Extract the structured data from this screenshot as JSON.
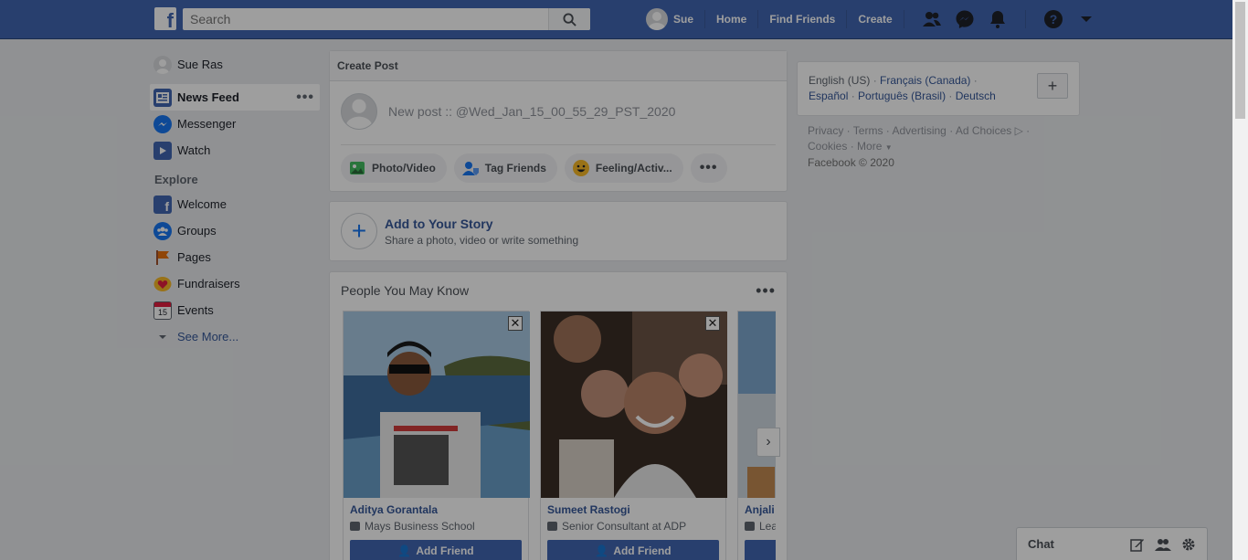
{
  "topbar": {
    "logo": "f",
    "search_placeholder": "Search",
    "user_name": "Sue",
    "nav": [
      "Home",
      "Find Friends",
      "Create"
    ]
  },
  "sidebar": {
    "profile_name": "Sue Ras",
    "items": [
      {
        "label": "News Feed",
        "icon": "news-feed-icon",
        "active": true
      },
      {
        "label": "Messenger",
        "icon": "messenger-icon"
      },
      {
        "label": "Watch",
        "icon": "watch-icon"
      }
    ],
    "explore_label": "Explore",
    "explore_items": [
      {
        "label": "Welcome",
        "icon": "facebook-icon"
      },
      {
        "label": "Groups",
        "icon": "groups-icon"
      },
      {
        "label": "Pages",
        "icon": "flag-icon"
      },
      {
        "label": "Fundraisers",
        "icon": "heart-icon"
      },
      {
        "label": "Events",
        "icon": "calendar-icon",
        "badge": "15"
      }
    ],
    "see_more": "See More..."
  },
  "create_post": {
    "header": "Create Post",
    "text": "New post :: @Wed_Jan_15_00_55_29_PST_2020",
    "actions": [
      "Photo/Video",
      "Tag Friends",
      "Feeling/Activ..."
    ]
  },
  "story": {
    "title": "Add to Your Story",
    "subtitle": "Share a photo, video or write something"
  },
  "pymk": {
    "title": "People You May Know",
    "add_label": "Add Friend",
    "people": [
      {
        "name": "Aditya Gorantala",
        "info": "Mays Business School"
      },
      {
        "name": "Sumeet Rastogi",
        "info": "Senior Consultant at ADP"
      },
      {
        "name": "Anjali",
        "info": "Lea"
      }
    ]
  },
  "right": {
    "current_lang": "English (US)",
    "langs": [
      "Français (Canada)",
      "Español",
      "Português (Brasil)",
      "Deutsch"
    ],
    "footer": [
      "Privacy",
      "Terms",
      "Advertising",
      "Ad Choices",
      "Cookies",
      "More"
    ],
    "copyright": "Facebook © 2020"
  },
  "chat": {
    "label": "Chat"
  },
  "colors": {
    "brand": "#4267b2",
    "link": "#365899",
    "background": "#e9ebee"
  }
}
